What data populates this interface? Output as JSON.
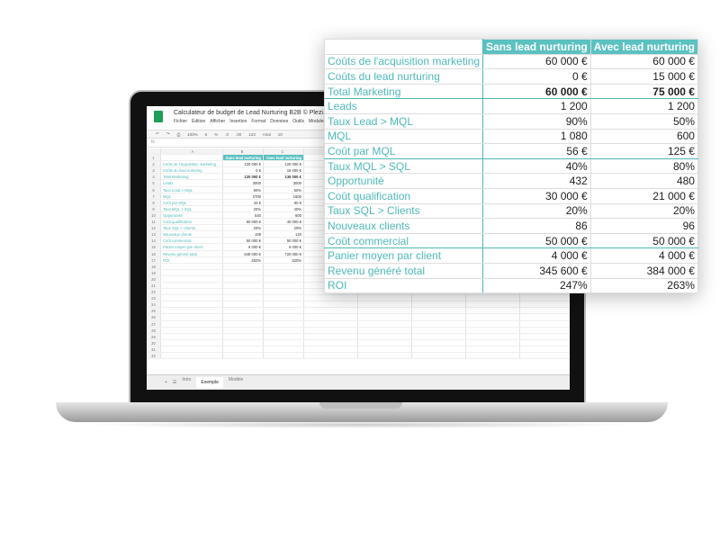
{
  "sheet": {
    "title": "Calculateur de budget de Lead Nurturing B2B © Plezi.co",
    "menu": [
      "Fichier",
      "Édition",
      "Afficher",
      "Insertion",
      "Format",
      "Données",
      "Outils",
      "Modules"
    ],
    "toolbar": [
      "↶",
      "↷",
      "⎙",
      "100%",
      "€",
      "%",
      ".0",
      ".00",
      "123",
      "Arial",
      "10"
    ],
    "fx": "fx",
    "columns": [
      "A",
      "B",
      "C",
      "D"
    ],
    "headers": [
      "",
      "Sans lead nurturing",
      "Avec lead nurturing"
    ],
    "rows": [
      [
        "Coûts de l'acquisition marketing",
        "120 000 €",
        "120 000 €"
      ],
      [
        "Coûts du lead nurturing",
        "0 €",
        "15 000 €"
      ],
      [
        "Total Marketing",
        "120 000 €",
        "135 000 €"
      ],
      [
        "Leads",
        "3000",
        "3000"
      ],
      [
        "Taux Lead > MQL",
        "90%",
        "50%"
      ],
      [
        "MQL",
        "2700",
        "1500"
      ],
      [
        "Coût par MQL",
        "44 €",
        "90 €"
      ],
      [
        "Taux MQL > SQL",
        "20%",
        "40%"
      ],
      [
        "Opportunité",
        "540",
        "600"
      ],
      [
        "Coût qualification",
        "60 000 €",
        "40 000 €"
      ],
      [
        "Taux SQL > Clients",
        "20%",
        "20%"
      ],
      [
        "Nouveaux clients",
        "108",
        "120"
      ],
      [
        "Coût commercial",
        "50 000 €",
        "50 000 €"
      ],
      [
        "Panier moyen par client",
        "6 000 €",
        "6 000 €"
      ],
      [
        "Revenu généré total",
        "648 000 €",
        "720 000 €"
      ],
      [
        "ROI",
        "282%",
        "320%"
      ]
    ],
    "tabs": [
      "Intro",
      "Exemple",
      "Modèle"
    ],
    "active_tab": "Exemple"
  },
  "overlay": {
    "headers": [
      "",
      "Sans lead nurturing",
      "Avec lead nurturing"
    ],
    "rows": [
      [
        "Coûts de l'acquisition marketing",
        "60 000 €",
        "60 000 €"
      ],
      [
        "Coûts du lead nurturing",
        "0 €",
        "15 000 €"
      ],
      [
        "Total Marketing",
        "60 000 €",
        "75 000 €"
      ],
      [
        "Leads",
        "1 200",
        "1 200"
      ],
      [
        "Taux Lead > MQL",
        "90%",
        "50%"
      ],
      [
        "MQL",
        "1 080",
        "600"
      ],
      [
        "Coût par MQL",
        "56 €",
        "125 €"
      ],
      [
        "Taux MQL > SQL",
        "40%",
        "80%"
      ],
      [
        "Opportunité",
        "432",
        "480"
      ],
      [
        "Coût qualification",
        "30 000 €",
        "21 000 €"
      ],
      [
        "Taux SQL > Clients",
        "20%",
        "20%"
      ],
      [
        "Nouveaux clients",
        "86",
        "96"
      ],
      [
        "Coût commercial",
        "50 000 €",
        "50 000 €"
      ],
      [
        "Panier moyen par client",
        "4 000 €",
        "4 000 €"
      ],
      [
        "Revenu généré total",
        "345 600 €",
        "384 000 €"
      ],
      [
        "ROI",
        "247%",
        "263%"
      ]
    ]
  },
  "colors": {
    "accent": "#4fb8b8",
    "header_bg": "#5bc1c1",
    "sheets_green": "#1e9e57"
  }
}
